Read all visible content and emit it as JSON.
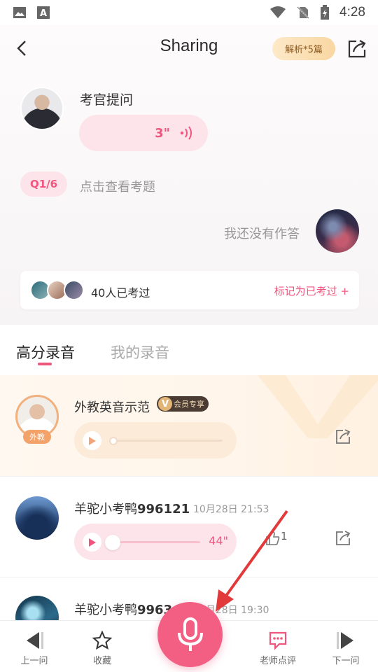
{
  "status_bar": {
    "time": "4:28",
    "icons": [
      "image-icon",
      "font-icon",
      "wifi-icon",
      "no-sim-icon",
      "battery-charging-icon"
    ]
  },
  "header": {
    "title": "Sharing",
    "analysis_label": "解析*5篇",
    "back_icon": "chevron-left-icon",
    "share_icon": "share-external-icon"
  },
  "question": {
    "examiner_label": "考官提问",
    "duration": "3\"",
    "badge": "Q1/6",
    "view_question": "点击查看考题",
    "no_answer_text": "我还没有作答"
  },
  "taken": {
    "count_text": "40人已考过",
    "mark_label": "标记为已考过 +"
  },
  "tabs": [
    {
      "label": "高分录音",
      "active": true
    },
    {
      "label": "我的录音",
      "active": false
    }
  ],
  "recordings": [
    {
      "name": "外教英音示范",
      "tag": "外教",
      "vip_label": "会员专享",
      "vip_letter": "V",
      "progress": 0
    },
    {
      "name_prefix": "羊驼小考鸭",
      "name_number": "996121",
      "time": "10月28日 21:53",
      "duration": "44\"",
      "likes": "1",
      "progress": 0
    },
    {
      "name_prefix": "羊驼小考鸭",
      "name_number": "99634",
      "time": "10月28日 19:30"
    }
  ],
  "bottom_nav": {
    "prev": "上一问",
    "favorite": "收藏",
    "teacher_review": "老师点评",
    "next": "下一问"
  },
  "colors": {
    "accent": "#f25f83",
    "accent_text": "#f0557e",
    "gold": "#f9d7a2"
  }
}
